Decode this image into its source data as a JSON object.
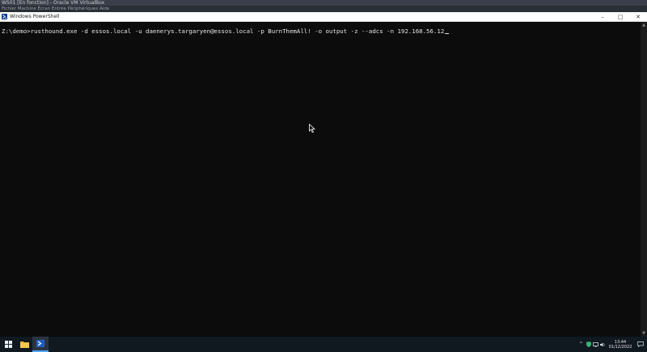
{
  "host": {
    "vm_title": "WS01 [En fonction] - Oracle VM VirtualBox",
    "vm_menu": "Fichier Machine Écran Entrée Périphériques Aide"
  },
  "window": {
    "title": "Windows PowerShell",
    "minimize": "–",
    "maximize": "□",
    "close": "✕"
  },
  "console": {
    "prompt": "Z:\\demo>",
    "command": "rusthound.exe -d essos.local -u daenerys.targaryen@essos.local -p BurnThemAll! -o output -z --adcs -n 192.168.56.12"
  },
  "taskbar": {
    "time": "13:44",
    "date": "01/12/2022",
    "tray_chevron": "^"
  },
  "colors": {
    "console_bg": "#0c0c0c",
    "console_fg": "#e6e6e6",
    "taskbar_bg": "#101820",
    "accent": "#4ca3ff"
  }
}
